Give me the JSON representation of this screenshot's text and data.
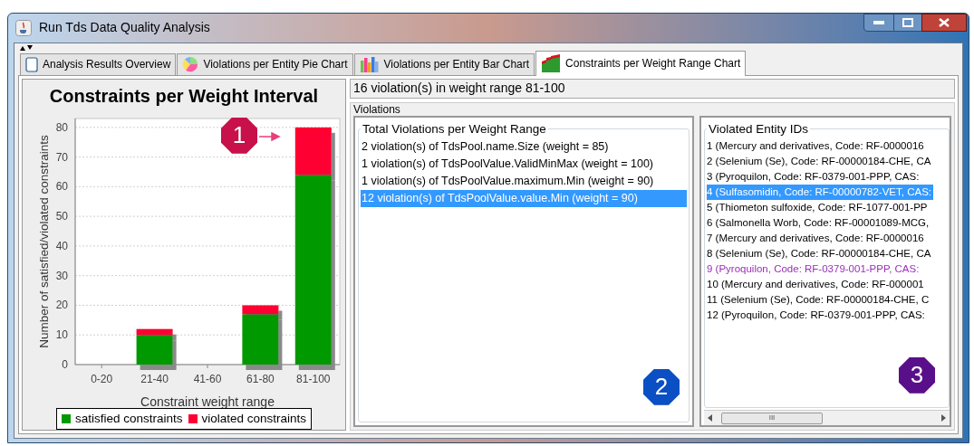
{
  "window": {
    "title": "Run Tds Data Quality Analysis"
  },
  "tabs": [
    {
      "label": "Analysis Results Overview",
      "kind": "notes",
      "selected": false
    },
    {
      "label": "Violations per Entity Pie Chart",
      "kind": "pie",
      "selected": false
    },
    {
      "label": "Violations per Entity Bar Chart",
      "kind": "bars",
      "selected": false
    },
    {
      "label": "Constraints per Weight Range Chart",
      "kind": "stacked",
      "selected": true
    }
  ],
  "chart_panel": {
    "callout": {
      "label": "1",
      "color": "#c8104a"
    },
    "chart_data": {
      "type": "bar",
      "stacked": true,
      "title": "Constraints per Weight Interval",
      "xlabel": "Constraint weight range",
      "ylabel": "Number of satisfied/violated constraints",
      "categories": [
        "0-20",
        "21-40",
        "41-60",
        "61-80",
        "81-100"
      ],
      "series": [
        {
          "name": "satisfied constraints",
          "color": "#009900",
          "values": [
            0,
            10,
            0,
            17,
            64
          ]
        },
        {
          "name": "violated constraints",
          "color": "#ff0033",
          "values": [
            0,
            2,
            0,
            3,
            16
          ]
        }
      ],
      "ylim": [
        0,
        83
      ],
      "grid": true,
      "yticks": [
        0,
        10,
        20,
        30,
        40,
        50,
        60,
        70,
        80
      ]
    }
  },
  "summary": "16 violation(s) in weight range 81-100",
  "violations_group": {
    "title": "Violations"
  },
  "violations_panel": {
    "title": "Total Violations per Weight Range",
    "callout": {
      "label": "2",
      "color": "#0a4fc4"
    },
    "items": [
      {
        "text": "2 violation(s) of TdsPool.name.Size (weight = 85)",
        "selected": false
      },
      {
        "text": "1 violation(s) of TdsPoolValue.ValidMinMax (weight = 100)",
        "selected": false
      },
      {
        "text": "1 violation(s) of TdsPoolValue.maximum.Min (weight = 90)",
        "selected": false
      },
      {
        "text": "12 violation(s) of TdsPoolValue.value.Min (weight = 90)",
        "selected": true
      }
    ]
  },
  "entities_panel": {
    "title": "Violated Entity IDs",
    "callout": {
      "label": "3",
      "color": "#5a0f8a"
    },
    "items": [
      {
        "text": "1 (Mercury and derivatives, Code: RF-0000016",
        "selected": false,
        "color": "#000000"
      },
      {
        "text": "2 (Selenium (Se), Code: RF-00000184-CHE, CA",
        "selected": false,
        "color": "#000000"
      },
      {
        "text": "3 (Pyroquilon, Code: RF-0379-001-PPP, CAS:",
        "selected": false,
        "color": "#000000"
      },
      {
        "text": "4 (Sulfasomidin, Code: RF-00000782-VET, CAS:",
        "selected": true
      },
      {
        "text": "5 (Thiometon sulfoxide, Code: RF-1077-001-PP",
        "selected": false,
        "color": "#000000"
      },
      {
        "text": "6 (Salmonella Worb, Code: RF-00001089-MCG,",
        "selected": false,
        "color": "#000000"
      },
      {
        "text": "7 (Mercury and derivatives, Code: RF-0000016",
        "selected": false,
        "color": "#000000"
      },
      {
        "text": "8 (Selenium (Se), Code: RF-00000184-CHE, CA",
        "selected": false,
        "color": "#000000"
      },
      {
        "text": "9 (Pyroquilon, Code: RF-0379-001-PPP, CAS:",
        "selected": false,
        "color": "#9b30b8"
      },
      {
        "text": "10 (Mercury and derivatives, Code: RF-000001",
        "selected": false,
        "color": "#000000"
      },
      {
        "text": "11 (Selenium (Se), Code: RF-00000184-CHE, C",
        "selected": false,
        "color": "#000000"
      },
      {
        "text": "12 (Pyroquilon, Code: RF-0379-001-PPP, CAS:",
        "selected": false,
        "color": "#000000"
      }
    ],
    "scrollbar_grip": "III"
  }
}
